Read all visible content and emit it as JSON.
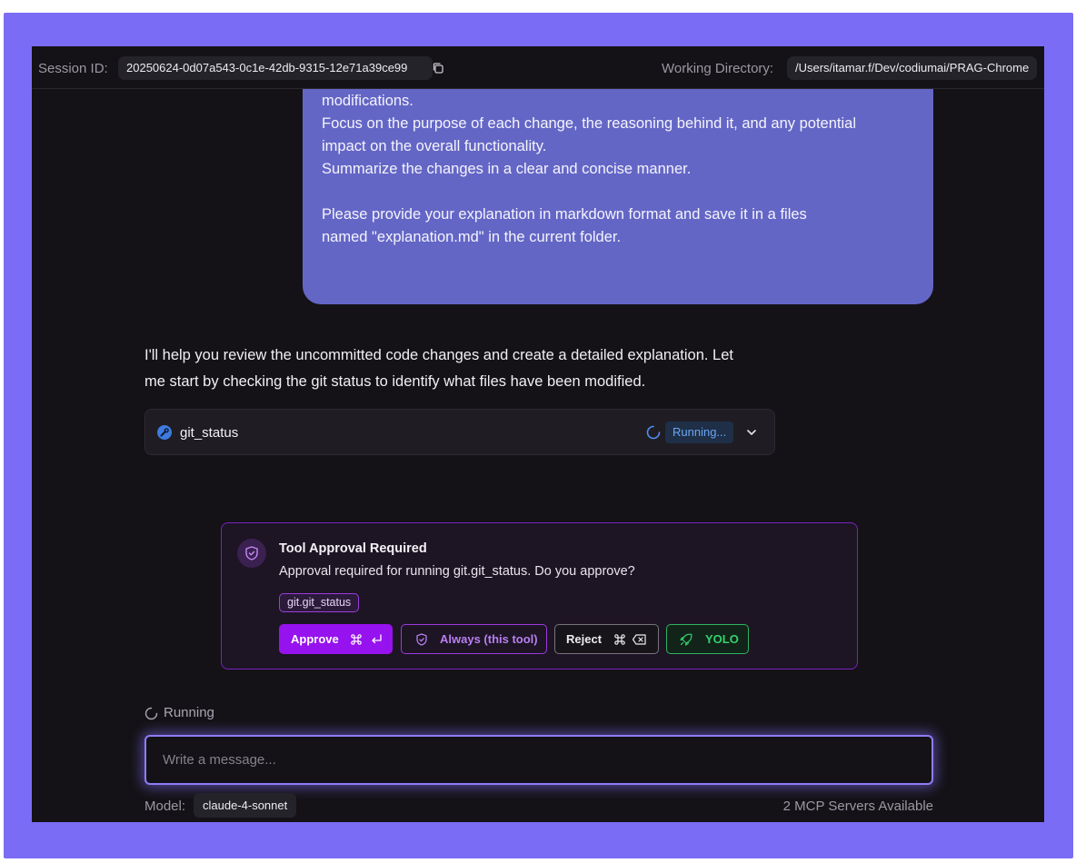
{
  "header": {
    "session_label": "Session ID:",
    "session_id": "20250624-0d07a543-0c1e-42db-9315-12e71a39ce99",
    "workdir_label": "Working Directory:",
    "workdir": "/Users/itamar.f/Dev/codiumai/PRAG-Chrome"
  },
  "user_message": {
    "lines": [
      "modifications.",
      "Focus on the purpose of each change, the reasoning behind it, and any potential",
      "impact on the overall functionality.",
      "Summarize the changes in a clear and concise manner.",
      "",
      "Please provide your explanation in markdown format and save it in a files",
      "named \"explanation.md\" in the current folder."
    ]
  },
  "assistant_message": {
    "lines": [
      "I'll help you review the uncommitted code changes and create a detailed explanation. Let",
      "me start by checking the git status to identify what files have been modified."
    ]
  },
  "tool_call": {
    "name": "git_status",
    "status": "Running...",
    "icon": "wrench-icon",
    "status_color": "#6aa5f5"
  },
  "approval": {
    "title": "Tool Approval Required",
    "message": "Approval required for running git.git_status. Do you approve?",
    "tool_tag": "git.git_status",
    "approve_label": "Approve",
    "always_label": "Always (this tool)",
    "reject_label": "Reject",
    "yolo_label": "YOLO",
    "accent_color": "#9612ee"
  },
  "status": {
    "running_label": "Running"
  },
  "composer": {
    "placeholder": "Write a message..."
  },
  "footer": {
    "model_label": "Model:",
    "model": "claude-4-sonnet",
    "servers": "2 MCP Servers Available"
  }
}
